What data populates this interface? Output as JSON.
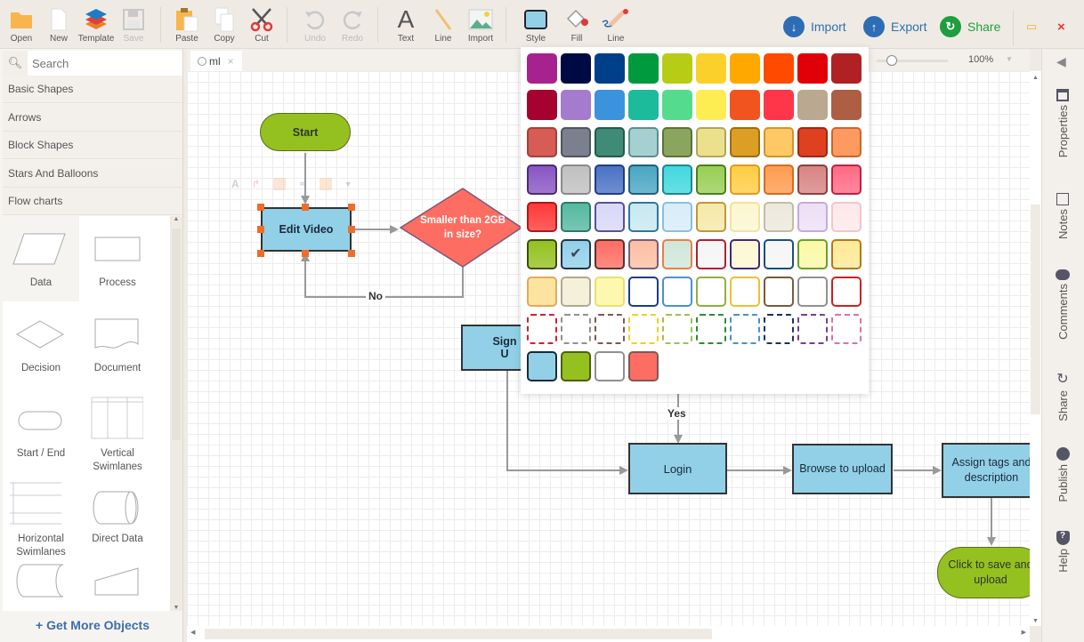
{
  "toolbar": {
    "buttons": [
      {
        "id": "open",
        "label": "Open",
        "icon": "folder-icon"
      },
      {
        "id": "new",
        "label": "New",
        "icon": "new-file-icon"
      },
      {
        "id": "template",
        "label": "Template",
        "icon": "template-layers-icon"
      },
      {
        "id": "save",
        "label": "Save",
        "icon": "floppy-disk-icon",
        "disabled": true
      },
      {
        "id": "paste",
        "label": "Paste",
        "icon": "clipboard-icon"
      },
      {
        "id": "copy",
        "label": "Copy",
        "icon": "copy-icon"
      },
      {
        "id": "cut",
        "label": "Cut",
        "icon": "scissors-icon"
      },
      {
        "id": "undo",
        "label": "Undo",
        "icon": "undo-icon",
        "disabled": true
      },
      {
        "id": "redo",
        "label": "Redo",
        "icon": "redo-icon",
        "disabled": true
      },
      {
        "id": "text",
        "label": "Text",
        "icon": "text-icon"
      },
      {
        "id": "line",
        "label": "Line",
        "icon": "line-icon"
      },
      {
        "id": "import",
        "label": "Import",
        "icon": "image-icon"
      },
      {
        "id": "style",
        "label": "Style",
        "icon": "style-swatch-icon"
      },
      {
        "id": "fill",
        "label": "Fill",
        "icon": "paint-bucket-icon"
      },
      {
        "id": "line-style",
        "label": "Line",
        "icon": "pencil-icon"
      }
    ],
    "right": {
      "import_label": "Import",
      "export_label": "Export",
      "share_label": "Share"
    },
    "colors": {
      "import": "#2d6db5",
      "export": "#2d6db5",
      "share": "#1e9e3e"
    }
  },
  "sidebar": {
    "search_placeholder": "Search",
    "categories": [
      "Basic Shapes",
      "Arrows",
      "Block Shapes",
      "Stars And Balloons",
      "Flow charts"
    ],
    "shapes": [
      {
        "label": "Data"
      },
      {
        "label": "Process"
      },
      {
        "label": "Decision"
      },
      {
        "label": "Document"
      },
      {
        "label": "Start / End"
      },
      {
        "label": "Vertical Swimlanes"
      },
      {
        "label": "Horizontal Swimlanes"
      },
      {
        "label": "Direct Data"
      },
      {
        "label": ""
      },
      {
        "label": ""
      }
    ],
    "get_more": "+ Get More Objects"
  },
  "document": {
    "tab_label": "ml",
    "zoom": "100%"
  },
  "right_panel": {
    "items": [
      "Properties",
      "Notes",
      "Comments",
      "Share",
      "Publish",
      "Help"
    ]
  },
  "palette": {
    "selected": "#92d0e8",
    "rows": [
      {
        "style": "solid",
        "colors": [
          "#a8228f",
          "#000a42",
          "#003f8a",
          "#009a3e",
          "#b7cc14",
          "#fcd02a",
          "#ffa800",
          "#ff4a00",
          "#e10008",
          "#af2123"
        ]
      },
      {
        "style": "solid",
        "colors": [
          "#a5022f",
          "#a57bcd",
          "#3b92dd",
          "#1bbb9b",
          "#55db8d",
          "#fdec52",
          "#f2541f",
          "#ff3549",
          "#bba891",
          "#ad5e43"
        ]
      },
      {
        "style": "bordered",
        "colors": [
          "#d65c55",
          "#7b7f8e",
          "#3f8b77",
          "#a6d0d0",
          "#8aa65e",
          "#ebe18d",
          "#dd9e25",
          "#fec965",
          "#de4020",
          "#fe9a60"
        ],
        "borders": [
          "#a34139",
          "#50545e",
          "#1f5d46",
          "#5c8e92",
          "#5a7238",
          "#b1a55c",
          "#9c6d12",
          "#d49332",
          "#9c2a12",
          "#c9652d"
        ]
      },
      {
        "style": "gradient",
        "colors": [
          "#8855c4",
          "#c0c0c0",
          "#4a72c4",
          "#4aa6c3",
          "#41d8de",
          "#98ce55",
          "#ffcc44",
          "#fe9b50",
          "#d88484",
          "#ff6a84"
        ],
        "borders": [
          "#4a2e6e",
          "#8a8a8a",
          "#1f3e80",
          "#205e7e",
          "#1a8a90",
          "#4c7f1c",
          "#e09b1e",
          "#d86a20",
          "#8c4040",
          "#c02040"
        ]
      },
      {
        "style": "gradient",
        "colors": [
          "#ff3838",
          "#56b8a0",
          "#d8d8f8",
          "#c8e8f0",
          "#d8ecf8",
          "#f6e8a8",
          "#fcf6d0",
          "#ece8dc",
          "#ece0f4",
          "#fde8ea"
        ],
        "borders": [
          "#b01818",
          "#2e7a60",
          "#5c4e9c",
          "#2c78a0",
          "#88c0e0",
          "#c0963c",
          "#f2e2a0",
          "#c4bca8",
          "#c8a8dc",
          "#f4c4cc"
        ]
      },
      {
        "style": "gradient",
        "colors": [
          "#94c11f",
          "#92d0e8",
          "#fe6d62",
          "#fbbfa3",
          "#cfe7da",
          "#f5f5f5",
          "#fdf8d2",
          "#f5f5f5",
          "#fcf8a8",
          "#fde996"
        ],
        "borders": [
          "#3a4d0c",
          "#243642",
          "#5a3030",
          "#7a5a7a",
          "#e68048",
          "#b02030",
          "#402a7a",
          "#1e4e7a",
          "#6aa030",
          "#b07a20"
        ]
      },
      {
        "style": "outline",
        "colors": [
          "#fde3a0",
          "#f4f0da",
          "#fcf8b0",
          "#ffffff",
          "#ffffff",
          "#ffffff",
          "#ffffff",
          "#ffffff",
          "#ffffff",
          "#ffffff"
        ],
        "borders": [
          "#e6a85a",
          "#b0a890",
          "#e8e070",
          "#1e3c8c",
          "#4a90d0",
          "#90b040",
          "#f0c030",
          "#7a5a40",
          "#909090",
          "#d02020"
        ]
      },
      {
        "style": "dashed",
        "colors": [
          "#ffffff",
          "#ffffff",
          "#ffffff",
          "#ffffff",
          "#ffffff",
          "#ffffff",
          "#ffffff",
          "#ffffff",
          "#ffffff",
          "#ffffff"
        ],
        "borders": [
          "#d02030",
          "#909090",
          "#7a5a50",
          "#f0d020",
          "#a0c050",
          "#2e8a3a",
          "#4a90d0",
          "#1e3060",
          "#7a3a9a",
          "#e070a0"
        ]
      },
      {
        "style": "recent",
        "colors": [
          "#92d0e8",
          "#94c11f",
          "#ffffff",
          "#fe6d62"
        ],
        "borders": [
          "#1a2a30",
          "#4a6010",
          "#909090",
          "#7a5a5a"
        ]
      }
    ]
  },
  "diagram": {
    "nodes": [
      {
        "id": "start",
        "text": "Start",
        "fill": "#94c11f"
      },
      {
        "id": "edit",
        "text": "Edit Video",
        "fill": "#92d0e8"
      },
      {
        "id": "decision",
        "text": "Smaller than 2GB in size?",
        "fill": "#fe6d62"
      },
      {
        "id": "signup",
        "text": "Sign U",
        "fill": "#92d0e8"
      },
      {
        "id": "login",
        "text": "Login",
        "fill": "#92d0e8"
      },
      {
        "id": "browse",
        "text": "Browse to upload",
        "fill": "#92d0e8"
      },
      {
        "id": "assign",
        "text": "Assign tags and description",
        "fill": "#92d0e8"
      },
      {
        "id": "save",
        "text": "Click to save and upload",
        "fill": "#94c11f"
      }
    ],
    "edge_labels": {
      "no": "No",
      "yes": "Yes"
    }
  }
}
